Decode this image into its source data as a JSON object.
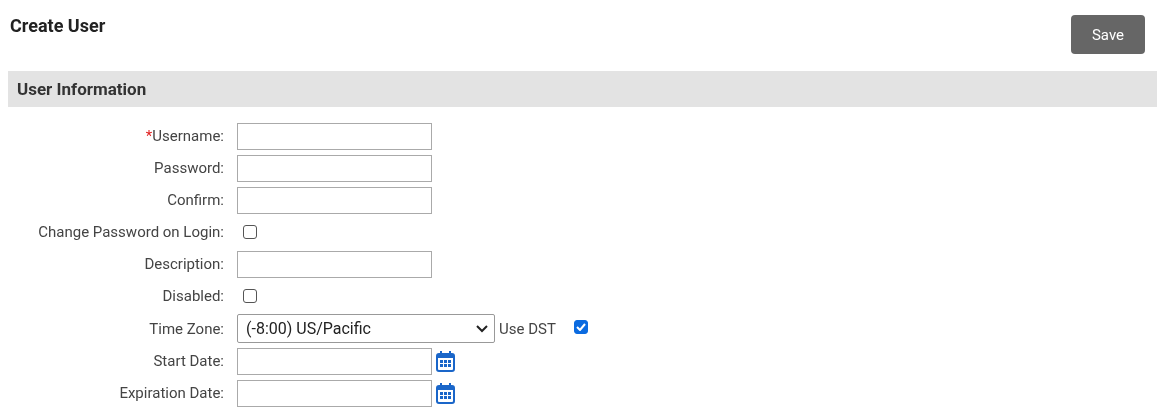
{
  "page": {
    "title": "Create User"
  },
  "save_button": "Save",
  "section": {
    "title": "User Information"
  },
  "fields": [
    {
      "kind": "text",
      "label": "Username:",
      "required_mark": "*"
    },
    {
      "kind": "text",
      "label": "Password:"
    },
    {
      "kind": "text",
      "label": "Confirm:"
    },
    {
      "kind": "checkbox",
      "label": "Change Password on Login:",
      "checked": false
    },
    {
      "kind": "text",
      "label": "Description:"
    },
    {
      "kind": "checkbox",
      "label": "Disabled:",
      "checked": false
    },
    {
      "kind": "select",
      "label": "Time Zone:",
      "value": "(-8:00) US/Pacific",
      "extra_label": "Use DST",
      "extra_checked": true
    },
    {
      "kind": "date",
      "label": "Start Date:"
    },
    {
      "kind": "date",
      "label": "Expiration Date:"
    }
  ]
}
